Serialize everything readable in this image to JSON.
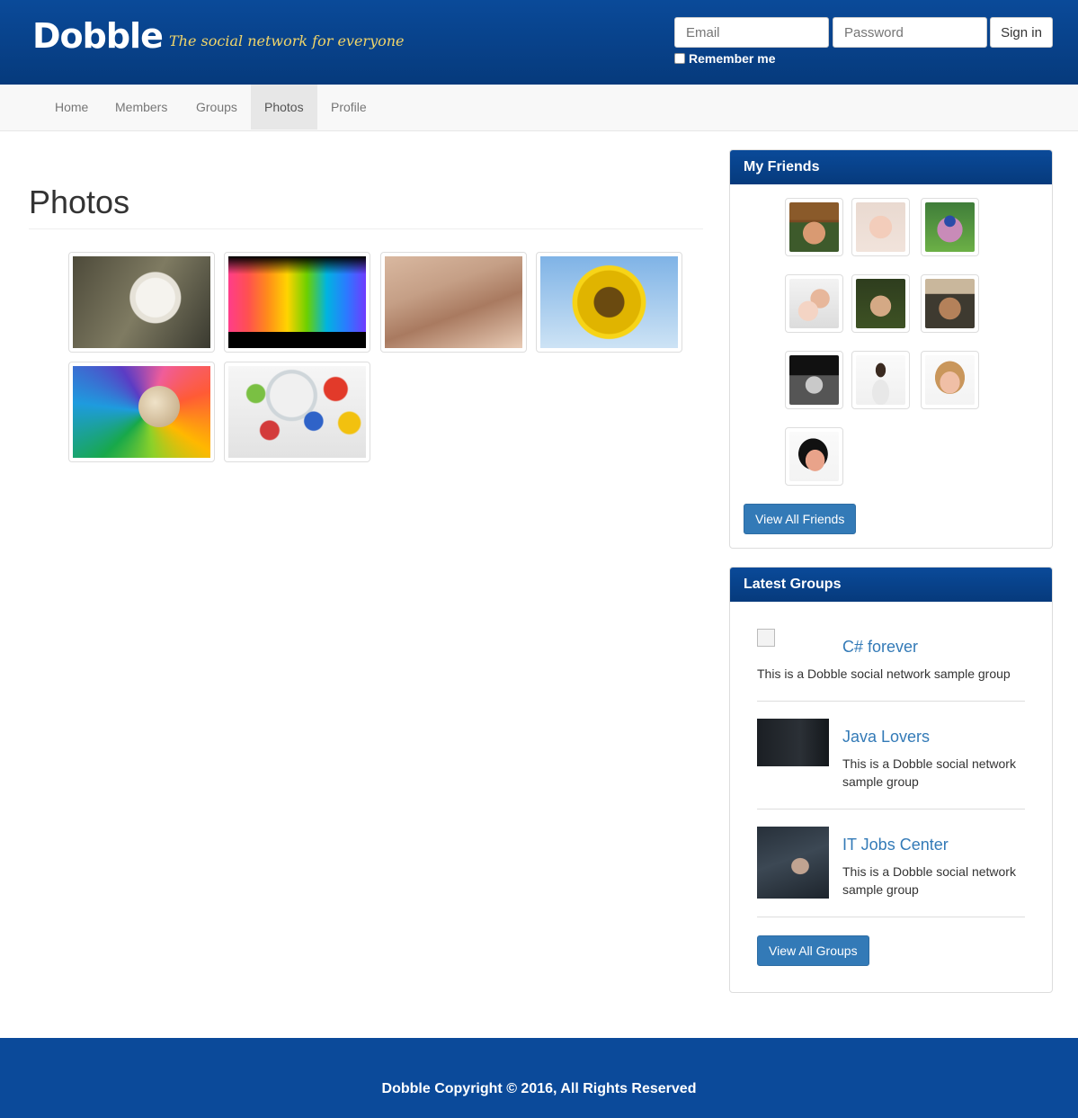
{
  "header": {
    "logo": "Dobble",
    "tagline": "The social network for everyone",
    "login": {
      "email_placeholder": "Email",
      "password_placeholder": "Password",
      "signin_label": "Sign in",
      "remember_label": "Remember me"
    }
  },
  "nav": {
    "items": [
      {
        "label": "Home",
        "active": false
      },
      {
        "label": "Members",
        "active": false
      },
      {
        "label": "Groups",
        "active": false
      },
      {
        "label": "Photos",
        "active": true
      },
      {
        "label": "Profile",
        "active": false
      }
    ]
  },
  "main": {
    "title": "Photos",
    "photos": [
      "eagle",
      "colored-tubes",
      "park-bench",
      "sunflower",
      "pinwheel",
      "marbles"
    ]
  },
  "friends_panel": {
    "title": "My Friends",
    "button_label": "View All Friends",
    "count_shown": 10
  },
  "groups_panel": {
    "title": "Latest Groups",
    "groups": [
      {
        "name": "C# forever",
        "description": "This is a Dobble social network sample group"
      },
      {
        "name": "Java Lovers",
        "description": "This is a Dobble social network sample group"
      },
      {
        "name": "IT Jobs Center",
        "description": "This is a Dobble social network sample group"
      }
    ],
    "button_label": "View All Groups"
  },
  "footer": {
    "copyright": "Dobble Copyright © 2016, All Rights Reserved"
  },
  "colors": {
    "header_blue": "#0a4a99",
    "link_blue": "#337ab7",
    "button_blue": "#337ab7",
    "tagline_yellow": "#f0d56a"
  }
}
